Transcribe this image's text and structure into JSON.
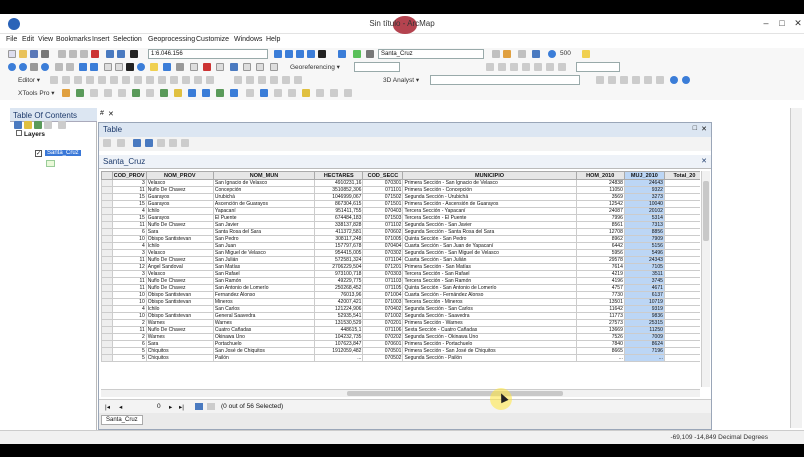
{
  "window": {
    "title": "Sin título - ArcMap",
    "minimize": "–",
    "maximize": "□",
    "close": "✕"
  },
  "menu": [
    "File",
    "Edit",
    "View",
    "Bookmarks",
    "Insert",
    "Selection",
    "Geoprocessing",
    "Customize",
    "Windows",
    "Help"
  ],
  "toolbars": {
    "scale": "1:6.046.156",
    "layer_select": "Santa_Cruz",
    "zoom_value": "500",
    "georeferencing": "Georeferencing ▾",
    "analyst": "3D Analyst ▾",
    "editor": "Editor ▾",
    "xtools": "XTools Pro ▾"
  },
  "toc": {
    "title": "Table Of Contents",
    "close": "✕",
    "pin": "#",
    "root": "Layers",
    "layer": "Santa_Cruz"
  },
  "table_window": {
    "title": "Table",
    "table_name": "Santa_Cruz",
    "close": "✕",
    "restore": "□"
  },
  "columns": [
    "COD_PROV",
    "NOM_PROV",
    "NOM_MUN",
    "HECTARES",
    "COD_SECC",
    "MUNICIPIO",
    "HOM_2010",
    "MUJ_2010",
    "Total_20"
  ],
  "rows": [
    [
      "3",
      "Velasco",
      "San Ignacio de Velasco",
      "4910231,16",
      "070301",
      "Primera Sección - San Ignacio de Velasco",
      "24838",
      "24643",
      ""
    ],
    [
      "11",
      "Ñuflo De Chavez",
      "Concepción",
      "3510852,306",
      "071101",
      "Primera Sección - Concepción",
      "11050",
      "9322",
      ""
    ],
    [
      "15",
      "Guarayos",
      "Urubichá",
      "1046999,067",
      "071502",
      "Segunda Sección - Urubichá",
      "3569",
      "3273",
      ""
    ],
    [
      "15",
      "Guarayos",
      "Ascención de Guarayos",
      "867304,615",
      "071501",
      "Primera Sección - Ascensión de Guarayos",
      "12542",
      "10040",
      ""
    ],
    [
      "4",
      "Ichilo",
      "Yapacaní",
      "951411,755",
      "070403",
      "Tercera Sección - Yapacaní",
      "24087",
      "20102",
      ""
    ],
    [
      "15",
      "Guarayos",
      "El Puente",
      "674484,183",
      "071503",
      "Tercera Sección - El Puente",
      "7996",
      "5314",
      ""
    ],
    [
      "11",
      "Ñuflo De Chavez",
      "San Javier",
      "338137,828",
      "071102",
      "Segunda Sección - San Javier",
      "8561",
      "7313",
      ""
    ],
    [
      "6",
      "Sara",
      "Santa Rosa del Sara",
      "411372,581",
      "070602",
      "Segunda Sección - Santa Rosa del Sara",
      "12708",
      "8856",
      ""
    ],
    [
      "10",
      "Obispo Santistevan",
      "San Pedro",
      "308117,248",
      "071005",
      "Quinta Sección - San Pedro",
      "8962",
      "7909",
      ""
    ],
    [
      "4",
      "Ichilo",
      "San Juan",
      "157797,678",
      "070404",
      "Cuarta Sección - San Juan de Yapacaní",
      "6442",
      "5156",
      ""
    ],
    [
      "3",
      "Velasco",
      "San Miguel de Velasco",
      "954415,005",
      "070302",
      "Segunda Sección - San Miguel de Velasco",
      "5956",
      "5496",
      ""
    ],
    [
      "11",
      "Ñuflo De Chavez",
      "San Julián",
      "572581,324",
      "071104",
      "Cuarta Sección - San Julián",
      "29578",
      "24343",
      ""
    ],
    [
      "12",
      "Angel Sandoval",
      "San Matías",
      "2706229,504",
      "071201",
      "Primera Sección - San Matías",
      "7614",
      "7105",
      ""
    ],
    [
      "3",
      "Velasco",
      "San Rafael",
      "973100,718",
      "070303",
      "Tercera Sección - San Rafael",
      "4219",
      "3511",
      ""
    ],
    [
      "11",
      "Ñuflo De Chavez",
      "San Ramón",
      "49229,775",
      "071103",
      "Tercera Sección - San Ramón",
      "4196",
      "3745",
      ""
    ],
    [
      "11",
      "Ñuflo De Chavez",
      "San Antonio de Lomerío",
      "250268,452",
      "071105",
      "Quinta Sección - San Antonio de Lomerío",
      "4757",
      "4671",
      ""
    ],
    [
      "10",
      "Obispo Santistevan",
      "Fernandez Alonso",
      "76013,96",
      "071004",
      "Cuarta Sección - Fernández Alonso",
      "7730",
      "6137",
      ""
    ],
    [
      "10",
      "Obispo Santistevan",
      "Mineros",
      "42007,421",
      "071003",
      "Tercera Sección - Mineros",
      "13501",
      "10719",
      ""
    ],
    [
      "4",
      "Ichilo",
      "San Carlos",
      "121224,906",
      "070402",
      "Segunda Sección - San Carlos",
      "11642",
      "9319",
      ""
    ],
    [
      "10",
      "Obispo Santistevan",
      "General Saavedra",
      "52935,541",
      "071002",
      "Segunda Sección - Saavedra",
      "11773",
      "9836",
      ""
    ],
    [
      "2",
      "Warnes",
      "Warnes",
      "131530,529",
      "070201",
      "Primera Sección - Warnes",
      "27573",
      "25315",
      ""
    ],
    [
      "11",
      "Ñuflo De Chavez",
      "Cuatro Cañadas",
      "448615,1",
      "071106",
      "Sexta Sección - Cuatro Cañadas",
      "13669",
      "11250",
      ""
    ],
    [
      "2",
      "Warnes",
      "Okinawa Uno",
      "104232,735",
      "070202",
      "Segunda Sección - Okinawa Uno",
      "7526",
      "7009",
      ""
    ],
    [
      "6",
      "Sara",
      "Portachuelo",
      "107623,847",
      "070601",
      "Primera Sección - Portachuelo",
      "7840",
      "8624",
      ""
    ],
    [
      "5",
      "Chiquitos",
      "San José de Chiquitos",
      "1912059,482",
      "070501",
      "Primera Sección - San José de Chiquitos",
      "8665",
      "7196",
      ""
    ],
    [
      "5",
      "Chiquitos",
      "Pailón",
      "...",
      "070502",
      "Segunda Sección - Pailón",
      "...",
      "...",
      ""
    ]
  ],
  "nav": {
    "first": "|◂",
    "prev": "◂",
    "current": "0",
    "next": "▸",
    "last": "▸|",
    "selection": "(0 out of 56 Selected)"
  },
  "bottom_tab": "Santa_Cruz",
  "status": {
    "coords": "-69,109  -14,849 Decimal Degrees"
  }
}
